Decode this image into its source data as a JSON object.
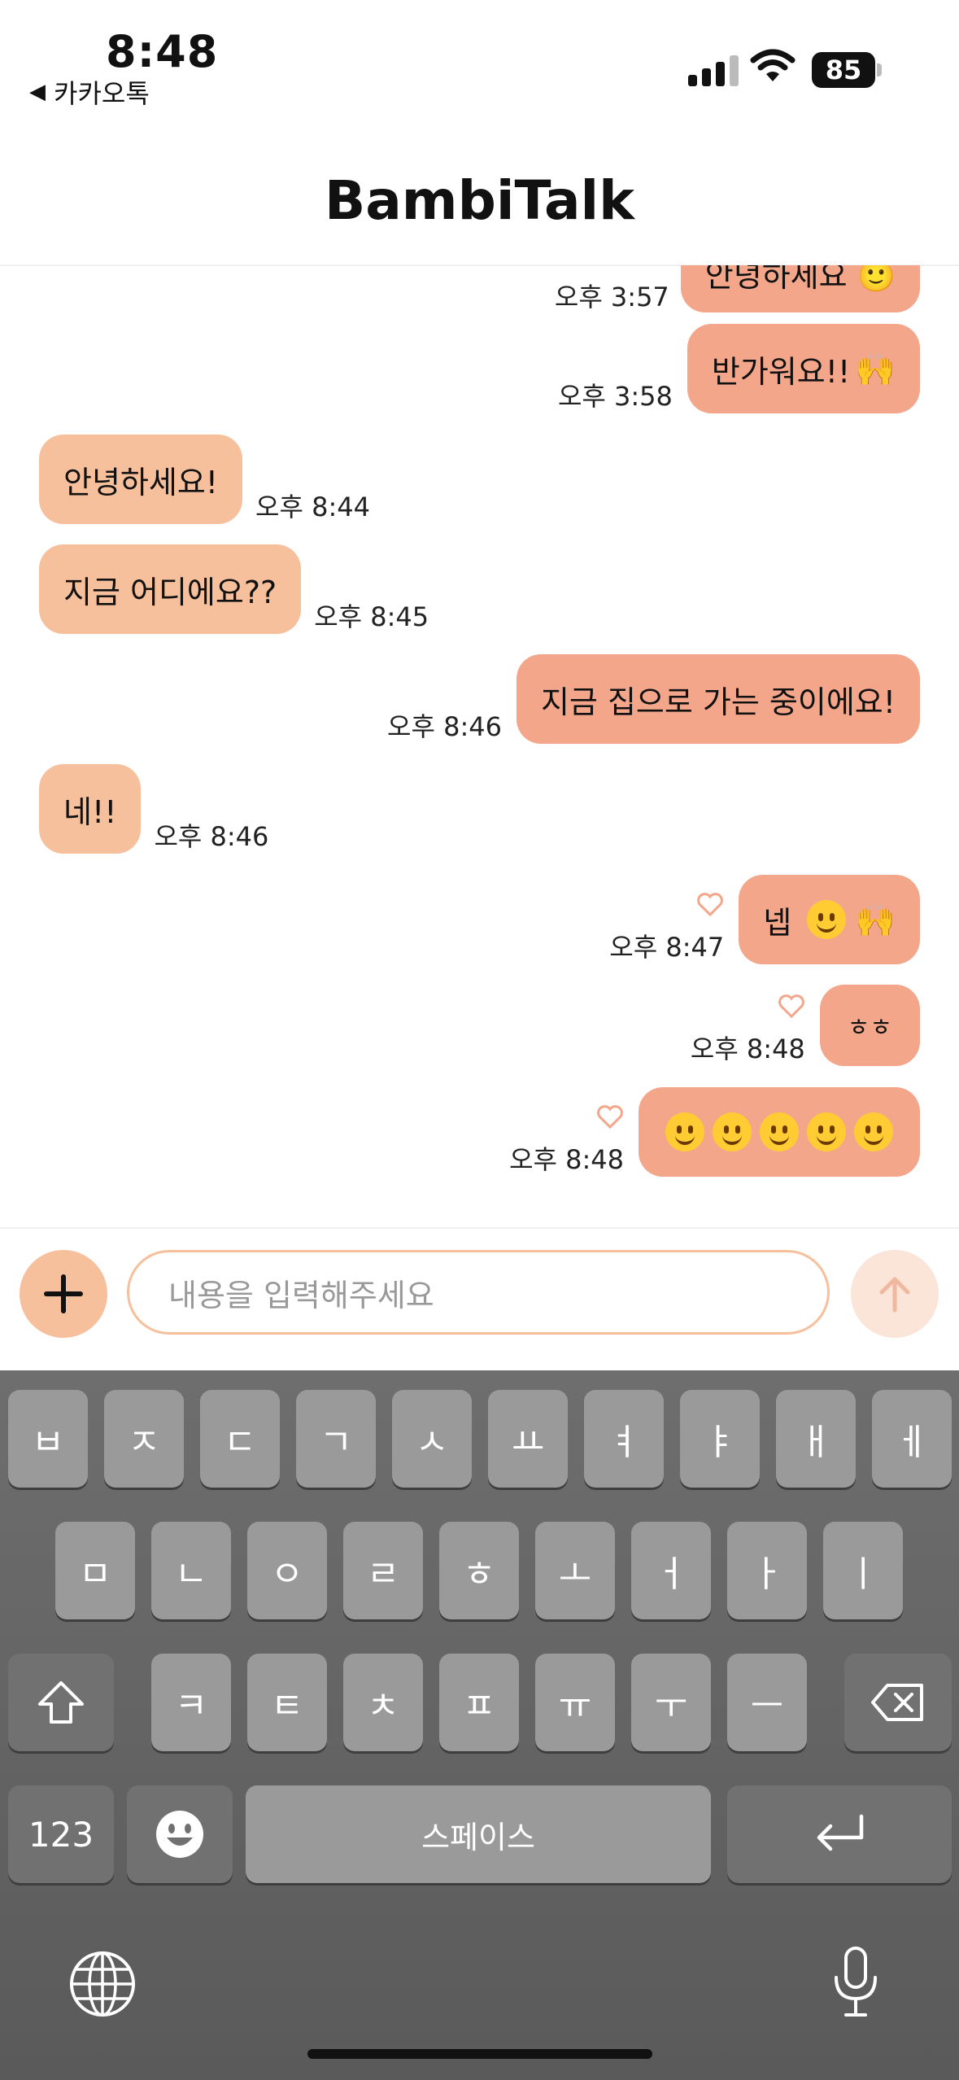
{
  "status_bar": {
    "time": "8:48",
    "back_app": "카카오톡",
    "battery": "85"
  },
  "header": {
    "title": "BambiTalk"
  },
  "messages": [
    {
      "side": "out",
      "text": "안녕하세요 🙂",
      "time": "오후 3:57",
      "partial": true
    },
    {
      "side": "out",
      "text": "반가워요!!",
      "time": "오후 3:58"
    },
    {
      "side": "in",
      "text": "안녕하세요!",
      "time": "오후 8:44"
    },
    {
      "side": "in",
      "text": "지금 어디에요??",
      "time": "오후 8:45"
    },
    {
      "side": "out",
      "text": "지금 집으로 가는 중이에요!",
      "time": "오후 8:46"
    },
    {
      "side": "in",
      "text": "네!!",
      "time": "오후 8:46"
    },
    {
      "side": "out",
      "text": "넵",
      "time": "오후 8:47",
      "heart": true
    },
    {
      "side": "out",
      "text": "ㅎㅎ",
      "time": "오후 8:48",
      "heart": true
    },
    {
      "side": "out",
      "text": "",
      "time": "오후 8:48",
      "heart": true,
      "emoji_count": 5
    }
  ],
  "input": {
    "placeholder": "내용을 입력해주세요"
  },
  "keyboard": {
    "row1": [
      "ㅂ",
      "ㅈ",
      "ㄷ",
      "ㄱ",
      "ㅅ",
      "ㅛ",
      "ㅕ",
      "ㅑ",
      "ㅐ",
      "ㅔ"
    ],
    "row2": [
      "ㅁ",
      "ㄴ",
      "ㅇ",
      "ㄹ",
      "ㅎ",
      "ㅗ",
      "ㅓ",
      "ㅏ",
      "ㅣ"
    ],
    "row3": [
      "ㅋ",
      "ㅌ",
      "ㅊ",
      "ㅍ",
      "ㅠ",
      "ㅜ",
      "ㅡ"
    ],
    "numbers_key": "123",
    "space_key": "스페이스"
  },
  "icons": {
    "plus": "plus-icon",
    "send": "arrow-up-icon",
    "shift": "shift-icon",
    "delete": "backspace-icon",
    "emoji": "emoji-icon",
    "return": "return-icon",
    "globe": "globe-icon",
    "mic": "microphone-icon",
    "heart": "heart-outline-icon"
  },
  "colors": {
    "incoming_bubble": "#f7c09c",
    "outgoing_bubble": "#f3a68a",
    "accent": "#f7c09c"
  }
}
